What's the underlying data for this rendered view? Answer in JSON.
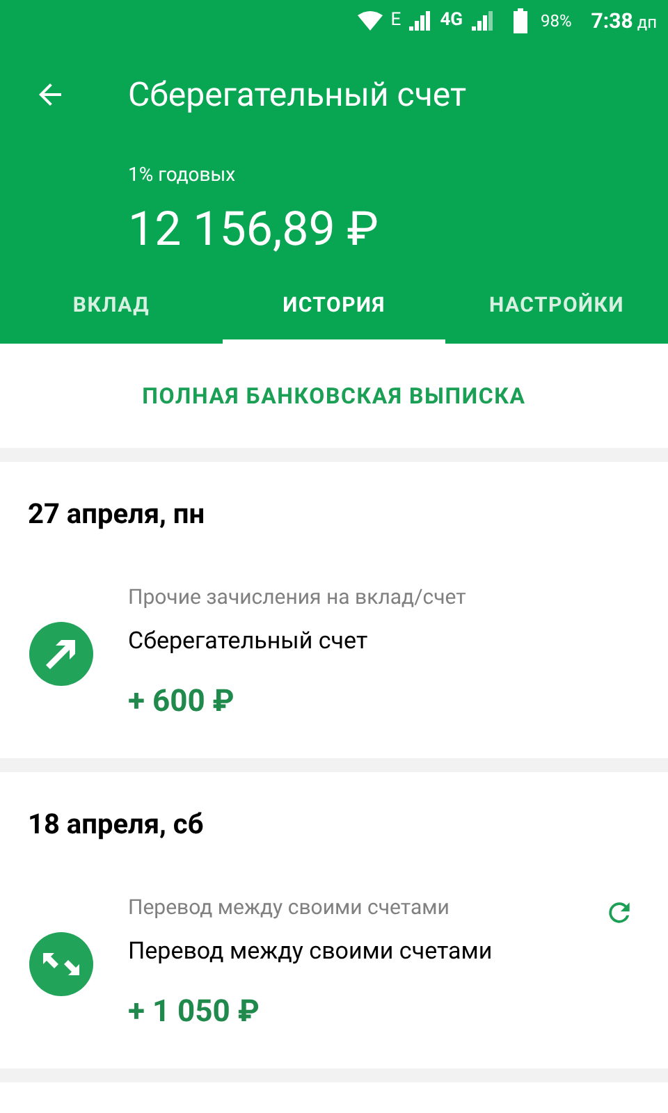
{
  "status_bar": {
    "network": "E",
    "network2": "4G",
    "battery": "98%",
    "time": "7:38",
    "time_suffix": "дп"
  },
  "header": {
    "title": "Сберегательный счет",
    "rate": "1% годовых",
    "balance": "12 156,89 ₽"
  },
  "tabs": [
    {
      "label": "ВКЛАД",
      "selected": false
    },
    {
      "label": "ИСТОРИЯ",
      "selected": true
    },
    {
      "label": "НАСТРОЙКИ",
      "selected": false
    }
  ],
  "statement_link": "ПОЛНАЯ БАНКОВСКАЯ ВЫПИСКА",
  "days": [
    {
      "date": "27 апреля, пн",
      "transactions": [
        {
          "kind": "income",
          "category": "Прочие зачисления на вклад/счет",
          "title": "Сберегательный счет",
          "amount": "+ 600 ₽",
          "repeat": false
        }
      ]
    },
    {
      "date": "18 апреля, сб",
      "transactions": [
        {
          "kind": "transfer",
          "category": "Перевод между своими счетами",
          "title": "Перевод между своими счетами",
          "amount": "+ 1 050 ₽",
          "repeat": true
        }
      ]
    }
  ]
}
